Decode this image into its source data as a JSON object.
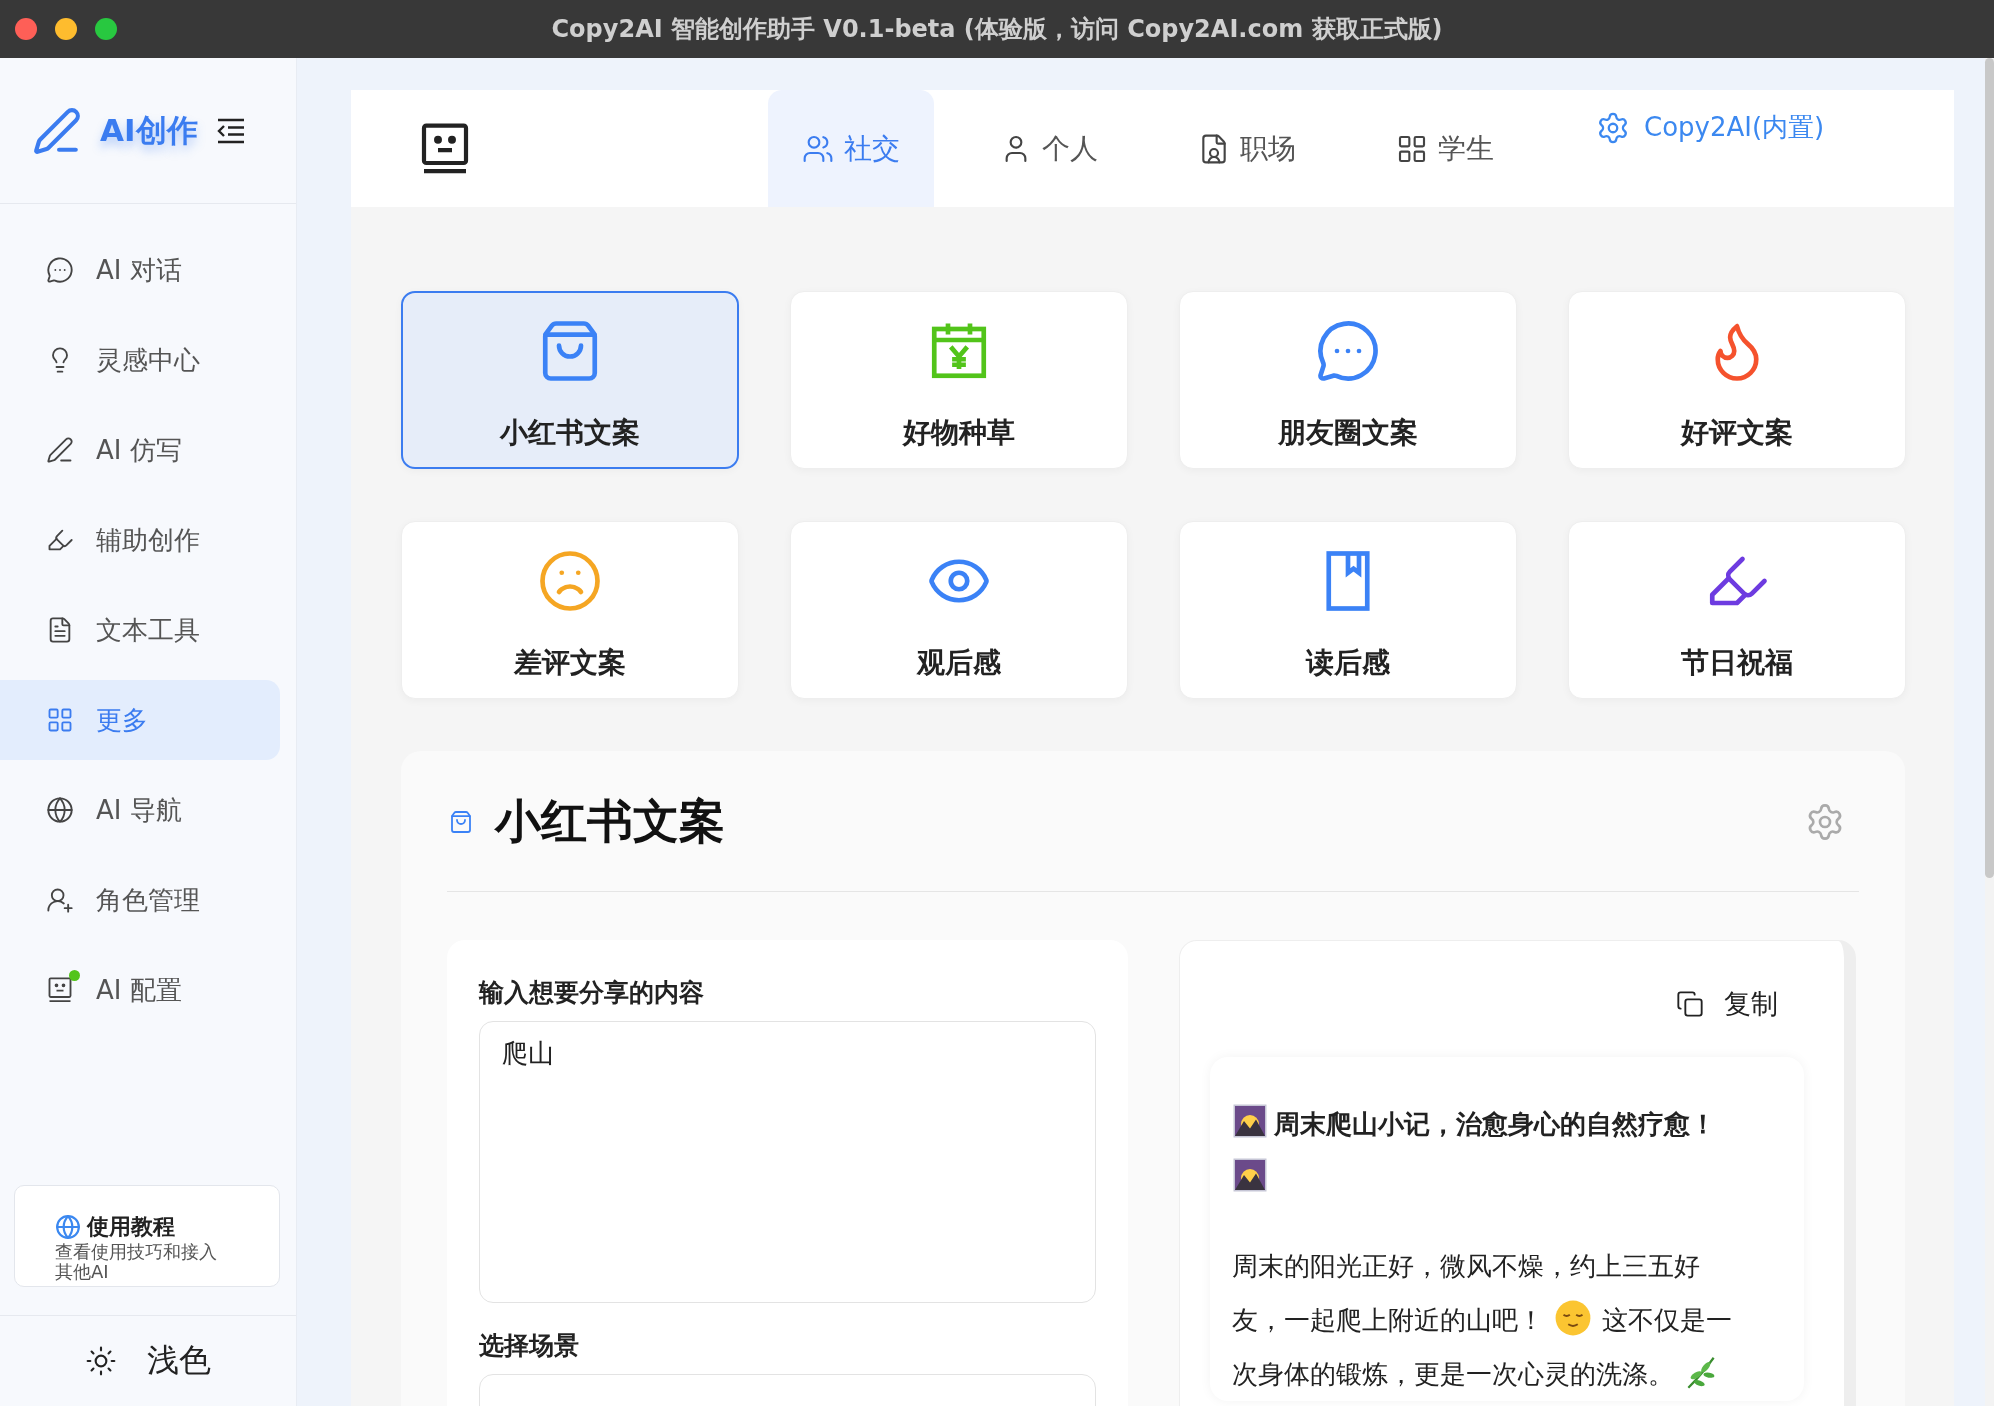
{
  "window": {
    "title": "Copy2AI 智能创作助手 V0.1-beta (体验版，访问 Copy2AI.com 获取正式版)"
  },
  "sidebar": {
    "brand": "AI创作",
    "items": [
      {
        "label": "AI 对话",
        "selected": false,
        "online": false
      },
      {
        "label": "灵感中心",
        "selected": false,
        "online": false
      },
      {
        "label": "AI 仿写",
        "selected": false,
        "online": false
      },
      {
        "label": "辅助创作",
        "selected": false,
        "online": false
      },
      {
        "label": "文本工具",
        "selected": false,
        "online": false
      },
      {
        "label": "更多",
        "selected": true,
        "online": false
      },
      {
        "label": "AI 导航",
        "selected": false,
        "online": false
      },
      {
        "label": "角色管理",
        "selected": false,
        "online": false
      },
      {
        "label": "AI 配置",
        "selected": false,
        "online": true
      }
    ],
    "tutorial": {
      "title": "使用教程",
      "description": "查看使用技巧和接入其他AI"
    },
    "theme": "浅色"
  },
  "top_tabs": [
    {
      "label": "社交",
      "selected": true
    },
    {
      "label": "个人",
      "selected": false
    },
    {
      "label": "职场",
      "selected": false
    },
    {
      "label": "学生",
      "selected": false
    }
  ],
  "model_link": "Copy2AI(内置)",
  "templates": [
    {
      "label": "小红书文案",
      "color": "#3b82f6",
      "selected": true
    },
    {
      "label": "好物种草",
      "color": "#52c41a",
      "selected": false
    },
    {
      "label": "朋友圈文案",
      "color": "#3b82f6",
      "selected": false
    },
    {
      "label": "好评文案",
      "color": "#f5522d",
      "selected": false
    },
    {
      "label": "差评文案",
      "color": "#f5a623",
      "selected": false
    },
    {
      "label": "观后感",
      "color": "#3b82f6",
      "selected": false
    },
    {
      "label": "读后感",
      "color": "#3b82f6",
      "selected": false
    },
    {
      "label": "节日祝福",
      "color": "#6d3be0",
      "selected": false
    }
  ],
  "panel": {
    "title": "小红书文案",
    "input_label": "输入想要分享的内容",
    "input_value": "爬山",
    "scene_label": "选择场景",
    "copy": "复制",
    "output": {
      "heading": [
        [
          {
            "kind": "emoji"
          },
          {
            "kind": "text",
            "text": "周末爬山小记，治愈身心的自然疗愈！"
          }
        ],
        [
          {
            "kind": "emoji"
          }
        ]
      ],
      "paragraph": [
        [
          {
            "kind": "text",
            "text": "周末的阳光正好，微风不燥，约上三五好"
          }
        ],
        [
          {
            "kind": "text",
            "text": "友，一起爬上附近的山吧！"
          },
          {
            "kind": "emoji"
          },
          {
            "kind": "text",
            "text": "这不仅是一"
          }
        ],
        [
          {
            "kind": "text",
            "text": "次身体的锻炼，更是一次心灵的洗涤。"
          },
          {
            "kind": "emoji"
          }
        ]
      ]
    }
  }
}
